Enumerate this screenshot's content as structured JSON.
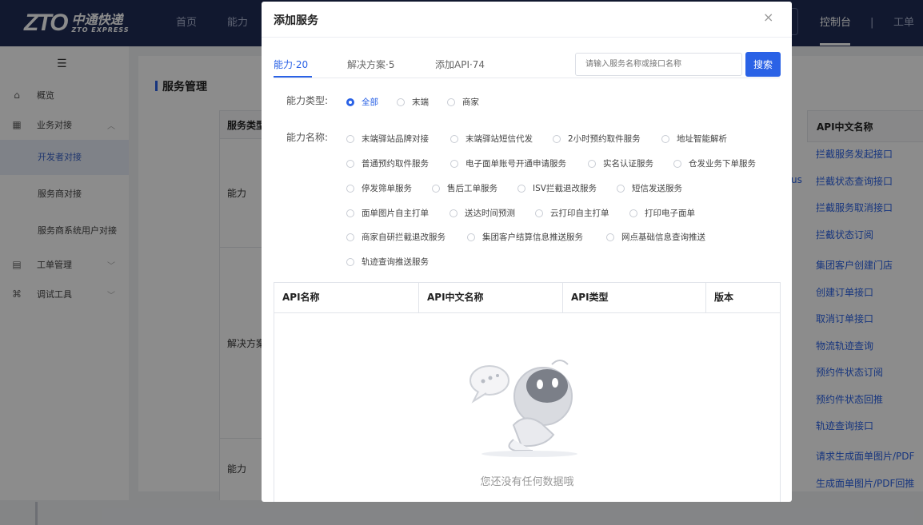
{
  "topbar": {
    "logo_mark": "ZTO",
    "logo_cn": "中通快递",
    "logo_en": "ZTO EXPRESS",
    "nav": [
      "首页",
      "能力"
    ],
    "console": "控制台",
    "separator": "|",
    "ticket": "工单"
  },
  "sidebar": {
    "items": [
      {
        "icon": "home-icon",
        "label": "概览"
      },
      {
        "icon": "grid-icon",
        "label": "业务对接",
        "chevron": "^"
      },
      {
        "label": "开发者对接"
      },
      {
        "label": "服务商对接"
      },
      {
        "label": "服务商系统用户对接"
      },
      {
        "icon": "ticket-icon",
        "label": "工单管理",
        "chevron": "v"
      },
      {
        "icon": "debug-icon",
        "label": "调试工具",
        "chevron": "v"
      }
    ]
  },
  "main": {
    "title": "服务管理",
    "col_service_type": "服务类型",
    "rows": [
      "能力",
      "解决方案",
      "能力"
    ],
    "partial_text": "us",
    "api_cn_header": "API中文名称",
    "api_links": [
      "拦截服务发起接口",
      "拦截状态查询接口",
      "拦截服务取消接口",
      "拦截状态订阅",
      "集团客户创建门店",
      "创建订单接口",
      "取消订单接口",
      "物流轨迹查询",
      "预约件状态订阅",
      "预约件状态回推",
      "轨迹查询接口",
      "请求生成面单图片/PDF",
      "生成面单图片/PDF回推"
    ]
  },
  "modal": {
    "title": "添加服务",
    "close": "×",
    "tabs": [
      "能力·20",
      "解决方案·5",
      "添加API·74"
    ],
    "search_placeholder": "请输入服务名称或接口名称",
    "search_button": "搜索",
    "type_label": "能力类型:",
    "type_options": [
      "全部",
      "末端",
      "商家"
    ],
    "type_selected": "全部",
    "name_label": "能力名称:",
    "name_options": [
      [
        "末端驿站品牌对接",
        "末端驿站短信代发",
        "2小时预约取件服务",
        "地址智能解析"
      ],
      [
        "普通预约取件服务",
        "电子面单账号开通申请服务",
        "实名认证服务",
        "仓发业务下单服务"
      ],
      [
        "停发筛单服务",
        "售后工单服务",
        "ISV拦截退改服务",
        "短信发送服务"
      ],
      [
        "面单图片自主打单",
        "送达时间预测",
        "云打印自主打单",
        "打印电子面单"
      ],
      [
        "商家自研拦截退改服务",
        "集团客户结算信息推送服务",
        "网点基础信息查询推送"
      ],
      [
        "轨迹查询推送服务"
      ]
    ],
    "table_headers": [
      "API名称",
      "API中文名称",
      "API类型",
      "版本"
    ],
    "empty_text": "您还没有任何数据哦"
  },
  "colors": {
    "primary": "#2a62e6",
    "nav_bg": "#1f2d56"
  }
}
